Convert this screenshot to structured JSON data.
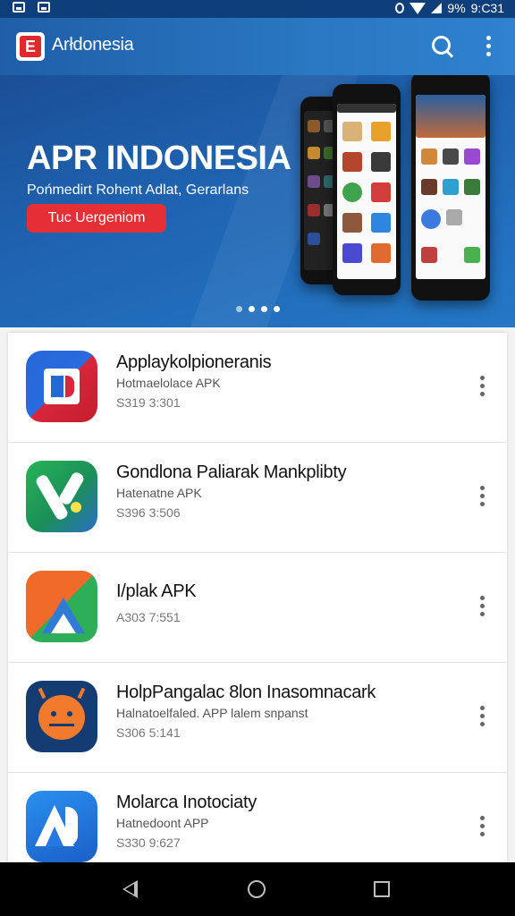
{
  "status_bar": {
    "time": "9:C31",
    "battery": "9%"
  },
  "app_bar": {
    "title": "Arłdonesia",
    "logo_letter": "E"
  },
  "banner": {
    "title": "APR INDONESIA",
    "subtitle": "Pońmedirt Rohent Adlat, Gerarlans",
    "cta": "Tuc Uergeniom",
    "active_dot": 3
  },
  "apps": [
    {
      "name": "Applaykolpioneranis",
      "sub": "Hotmaelolace APK",
      "meta": "S319 3:301",
      "icon": "blue-red-d-icon"
    },
    {
      "name": "Gondlona Paliarak Mankplibty",
      "sub": "Hatenatne APK",
      "meta": "S396 3:506",
      "icon": "green-k-icon"
    },
    {
      "name": "I/plak APK",
      "sub": "",
      "meta": "A303 7:551",
      "icon": "triangle-play-icon"
    },
    {
      "name": "HolpPangalac 8lon Inasomnacark",
      "sub": "Halnatoelfaled. APP lalem snpanst",
      "meta": "S306 5:141",
      "icon": "android-robot-icon"
    },
    {
      "name": "Molarca Inotociaty",
      "sub": "Hatnedoont APP",
      "meta": "S330 9:627",
      "icon": "ar-logo-icon"
    }
  ],
  "colors": {
    "app_bar": "#2a77c2",
    "banner": "#1f64b2",
    "cta": "#e62e35",
    "nav_bar": "#000000"
  }
}
